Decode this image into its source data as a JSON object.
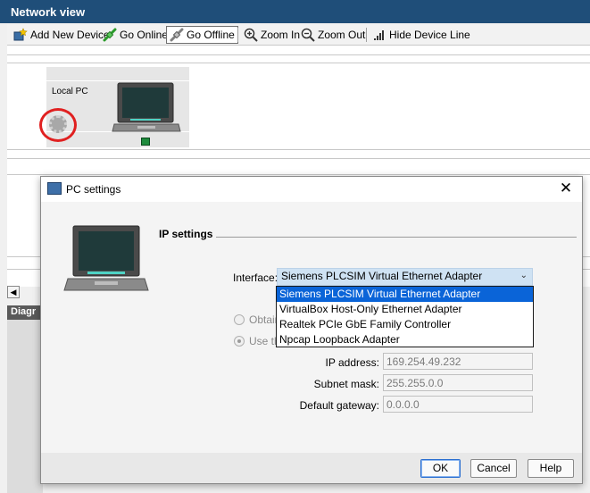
{
  "network_view": {
    "title": "Network view",
    "toolbar": {
      "add_device": "Add New Device",
      "go_online": "Go Online",
      "go_offline": "Go Offline",
      "zoom_in": "Zoom In",
      "zoom_out": "Zoom Out",
      "hide_device_line": "Hide Device Line"
    },
    "device": {
      "label": "Local PC"
    },
    "diagnostics_label": "Diagr"
  },
  "dialog": {
    "title": "PC settings",
    "close_glyph": "✕",
    "section_heading": "IP settings",
    "interface_label": "Interface:",
    "interface_value": "Siemens PLCSIM Virtual Ethernet Adapter",
    "interface_options": [
      "Siemens PLCSIM Virtual Ethernet Adapter",
      "VirtualBox Host-Only Ethernet Adapter",
      "Realtek PCIe GbE Family Controller",
      "Npcap Loopback Adapter"
    ],
    "radio_obtain": "Obtain",
    "radio_use": "Use th",
    "ip_address_label": "IP address:",
    "ip_address_value": "169.254.49.232",
    "subnet_mask_label": "Subnet mask:",
    "subnet_mask_value": "255.255.0.0",
    "gateway_label": "Default gateway:",
    "gateway_value": "0.0.0.0",
    "ok": "OK",
    "cancel": "Cancel",
    "help": "Help"
  },
  "colors": {
    "titlebar": "#1f4e79",
    "selection": "#0a64d8",
    "highlight_circle": "#e02020",
    "port": "#1e8a3c"
  }
}
